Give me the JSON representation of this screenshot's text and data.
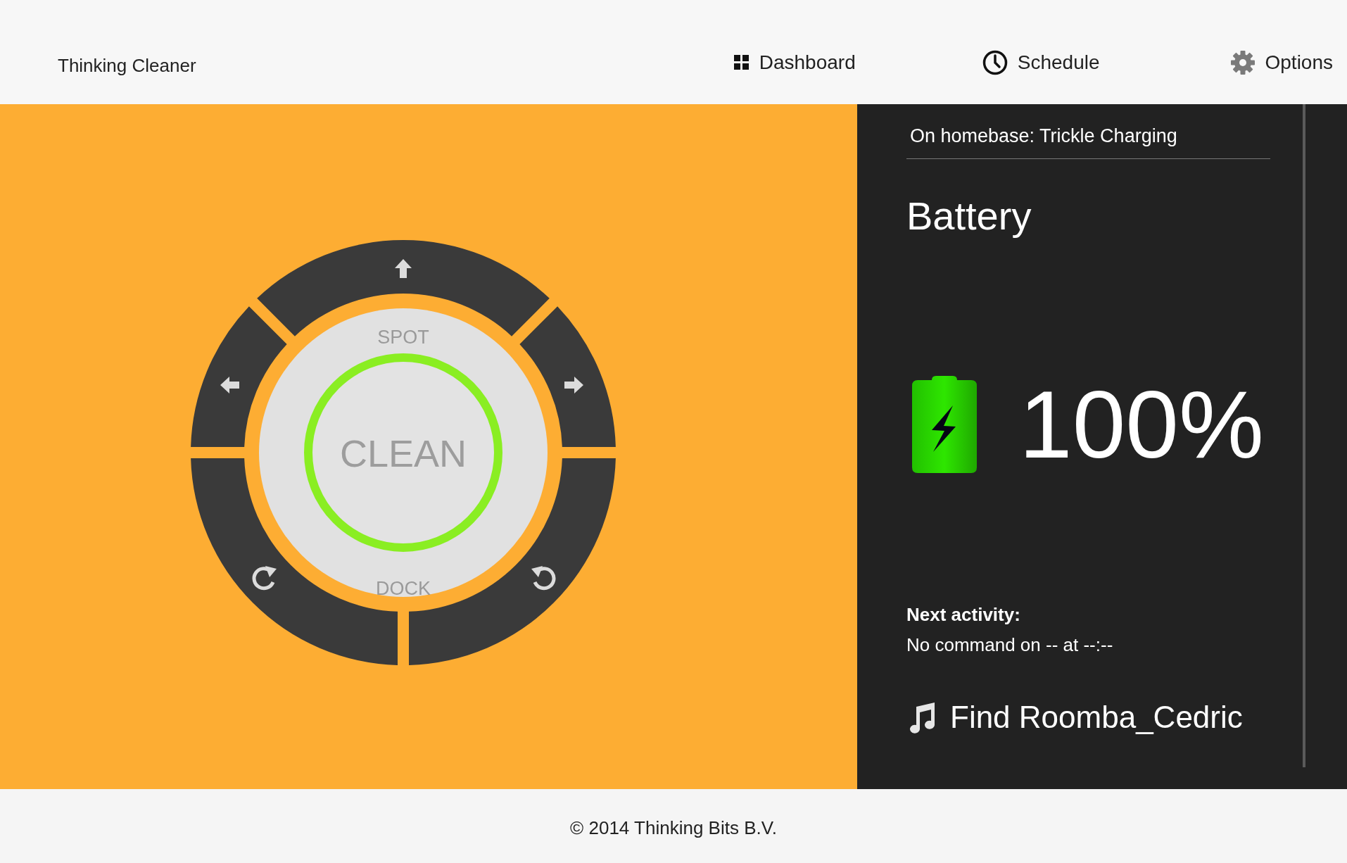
{
  "header": {
    "brand": "Thinking Cleaner",
    "nav": [
      {
        "kind": "dashboard",
        "label": "Dashboard"
      },
      {
        "kind": "schedule",
        "label": "Schedule"
      },
      {
        "kind": "options",
        "label": "Options"
      }
    ]
  },
  "remote": {
    "spot": "SPOT",
    "clean": "CLEAN",
    "dock": "DOCK"
  },
  "status": {
    "text": "On homebase: Trickle Charging",
    "battery_title": "Battery",
    "battery_value": "100%",
    "next_label": "Next activity:",
    "next_value": "No command on -- at --:--",
    "find": "Find Roomba_Cedric"
  },
  "footer": "© 2014 Thinking Bits B.V."
}
